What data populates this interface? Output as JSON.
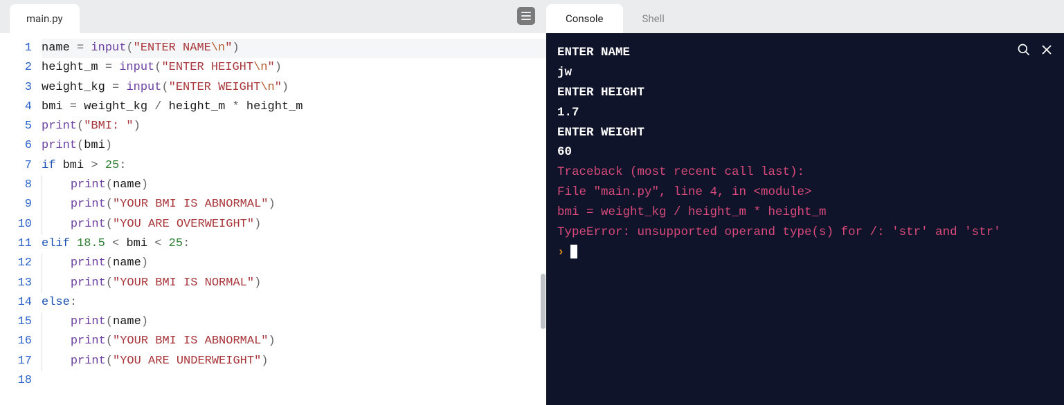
{
  "editor": {
    "filename": "main.py",
    "lines": [
      {
        "n": 1,
        "tokens": [
          {
            "t": "name",
            "c": "id"
          },
          {
            "t": " = ",
            "c": "op"
          },
          {
            "t": "input",
            "c": "fn"
          },
          {
            "t": "(",
            "c": "op"
          },
          {
            "t": "\"ENTER NAME",
            "c": "str"
          },
          {
            "t": "\\n",
            "c": "esc"
          },
          {
            "t": "\"",
            "c": "str"
          },
          {
            "t": ")",
            "c": "op"
          }
        ],
        "active": true
      },
      {
        "n": 2,
        "tokens": [
          {
            "t": "height_m",
            "c": "id"
          },
          {
            "t": " = ",
            "c": "op"
          },
          {
            "t": "input",
            "c": "fn"
          },
          {
            "t": "(",
            "c": "op"
          },
          {
            "t": "\"ENTER HEIGHT",
            "c": "str"
          },
          {
            "t": "\\n",
            "c": "esc"
          },
          {
            "t": "\"",
            "c": "str"
          },
          {
            "t": ")",
            "c": "op"
          }
        ]
      },
      {
        "n": 3,
        "tokens": [
          {
            "t": "weight_kg",
            "c": "id"
          },
          {
            "t": " = ",
            "c": "op"
          },
          {
            "t": "input",
            "c": "fn"
          },
          {
            "t": "(",
            "c": "op"
          },
          {
            "t": "\"ENTER WEIGHT",
            "c": "str"
          },
          {
            "t": "\\n",
            "c": "esc"
          },
          {
            "t": "\"",
            "c": "str"
          },
          {
            "t": ")",
            "c": "op"
          }
        ]
      },
      {
        "n": 4,
        "tokens": [
          {
            "t": "bmi",
            "c": "id"
          },
          {
            "t": " = ",
            "c": "op"
          },
          {
            "t": "weight_kg",
            "c": "id"
          },
          {
            "t": " / ",
            "c": "op"
          },
          {
            "t": "height_m",
            "c": "id"
          },
          {
            "t": " * ",
            "c": "op"
          },
          {
            "t": "height_m",
            "c": "id"
          }
        ]
      },
      {
        "n": 5,
        "tokens": [
          {
            "t": "print",
            "c": "fn"
          },
          {
            "t": "(",
            "c": "op"
          },
          {
            "t": "\"BMI: \"",
            "c": "str"
          },
          {
            "t": ")",
            "c": "op"
          }
        ]
      },
      {
        "n": 6,
        "tokens": [
          {
            "t": "print",
            "c": "fn"
          },
          {
            "t": "(",
            "c": "op"
          },
          {
            "t": "bmi",
            "c": "id"
          },
          {
            "t": ")",
            "c": "op"
          }
        ]
      },
      {
        "n": 7,
        "tokens": [
          {
            "t": "if",
            "c": "kw"
          },
          {
            "t": " ",
            "c": "op"
          },
          {
            "t": "bmi",
            "c": "id"
          },
          {
            "t": " > ",
            "c": "op"
          },
          {
            "t": "25",
            "c": "num"
          },
          {
            "t": ":",
            "c": "op"
          }
        ]
      },
      {
        "n": 8,
        "indent": 1,
        "tokens": [
          {
            "t": "print",
            "c": "fn"
          },
          {
            "t": "(",
            "c": "op"
          },
          {
            "t": "name",
            "c": "id"
          },
          {
            "t": ")",
            "c": "op"
          }
        ]
      },
      {
        "n": 9,
        "indent": 1,
        "tokens": [
          {
            "t": "print",
            "c": "fn"
          },
          {
            "t": "(",
            "c": "op"
          },
          {
            "t": "\"YOUR BMI IS ABNORMAL\"",
            "c": "str"
          },
          {
            "t": ")",
            "c": "op"
          }
        ]
      },
      {
        "n": 10,
        "indent": 1,
        "tokens": [
          {
            "t": "print",
            "c": "fn"
          },
          {
            "t": "(",
            "c": "op"
          },
          {
            "t": "\"YOU ARE OVERWEIGHT\"",
            "c": "str"
          },
          {
            "t": ")",
            "c": "op"
          }
        ]
      },
      {
        "n": 11,
        "tokens": [
          {
            "t": "elif",
            "c": "kw"
          },
          {
            "t": " ",
            "c": "op"
          },
          {
            "t": "18.5",
            "c": "num"
          },
          {
            "t": " < ",
            "c": "op"
          },
          {
            "t": "bmi",
            "c": "id"
          },
          {
            "t": " < ",
            "c": "op"
          },
          {
            "t": "25",
            "c": "num"
          },
          {
            "t": ":",
            "c": "op"
          }
        ]
      },
      {
        "n": 12,
        "indent": 1,
        "tokens": [
          {
            "t": "print",
            "c": "fn"
          },
          {
            "t": "(",
            "c": "op"
          },
          {
            "t": "name",
            "c": "id"
          },
          {
            "t": ")",
            "c": "op"
          }
        ]
      },
      {
        "n": 13,
        "indent": 1,
        "tokens": [
          {
            "t": "print",
            "c": "fn"
          },
          {
            "t": "(",
            "c": "op"
          },
          {
            "t": "\"YOUR BMI IS NORMAL\"",
            "c": "str"
          },
          {
            "t": ")",
            "c": "op"
          }
        ]
      },
      {
        "n": 14,
        "tokens": [
          {
            "t": "else",
            "c": "kw"
          },
          {
            "t": ":",
            "c": "op"
          }
        ]
      },
      {
        "n": 15,
        "indent": 1,
        "tokens": [
          {
            "t": "print",
            "c": "fn"
          },
          {
            "t": "(",
            "c": "op"
          },
          {
            "t": "name",
            "c": "id"
          },
          {
            "t": ")",
            "c": "op"
          }
        ]
      },
      {
        "n": 16,
        "indent": 1,
        "tokens": [
          {
            "t": "print",
            "c": "fn"
          },
          {
            "t": "(",
            "c": "op"
          },
          {
            "t": "\"YOUR BMI IS ABNORMAL\"",
            "c": "str"
          },
          {
            "t": ")",
            "c": "op"
          }
        ]
      },
      {
        "n": 17,
        "indent": 1,
        "tokens": [
          {
            "t": "print",
            "c": "fn"
          },
          {
            "t": "(",
            "c": "op"
          },
          {
            "t": "\"YOU ARE UNDERWEIGHT\"",
            "c": "str"
          },
          {
            "t": ")",
            "c": "op"
          }
        ]
      },
      {
        "n": 18,
        "tokens": []
      }
    ]
  },
  "rightTabs": {
    "console": "Console",
    "shell": "Shell"
  },
  "console": {
    "lines": [
      {
        "text": "ENTER NAME",
        "cls": "c-white"
      },
      {
        "text": "jw",
        "cls": "c-white"
      },
      {
        "text": "ENTER HEIGHT",
        "cls": "c-white"
      },
      {
        "text": "1.7",
        "cls": "c-white"
      },
      {
        "text": "ENTER WEIGHT",
        "cls": "c-white"
      },
      {
        "text": "60",
        "cls": "c-white"
      },
      {
        "text": "Traceback (most recent call last):",
        "cls": "c-err"
      },
      {
        "text": "  File \"main.py\", line 4, in <module>",
        "cls": "c-err"
      },
      {
        "text": "    bmi = weight_kg / height_m * height_m",
        "cls": "c-err"
      },
      {
        "text": "TypeError: unsupported operand type(s) for /: 'str' and 'str'",
        "cls": "c-err"
      }
    ],
    "promptSymbol": "›"
  }
}
